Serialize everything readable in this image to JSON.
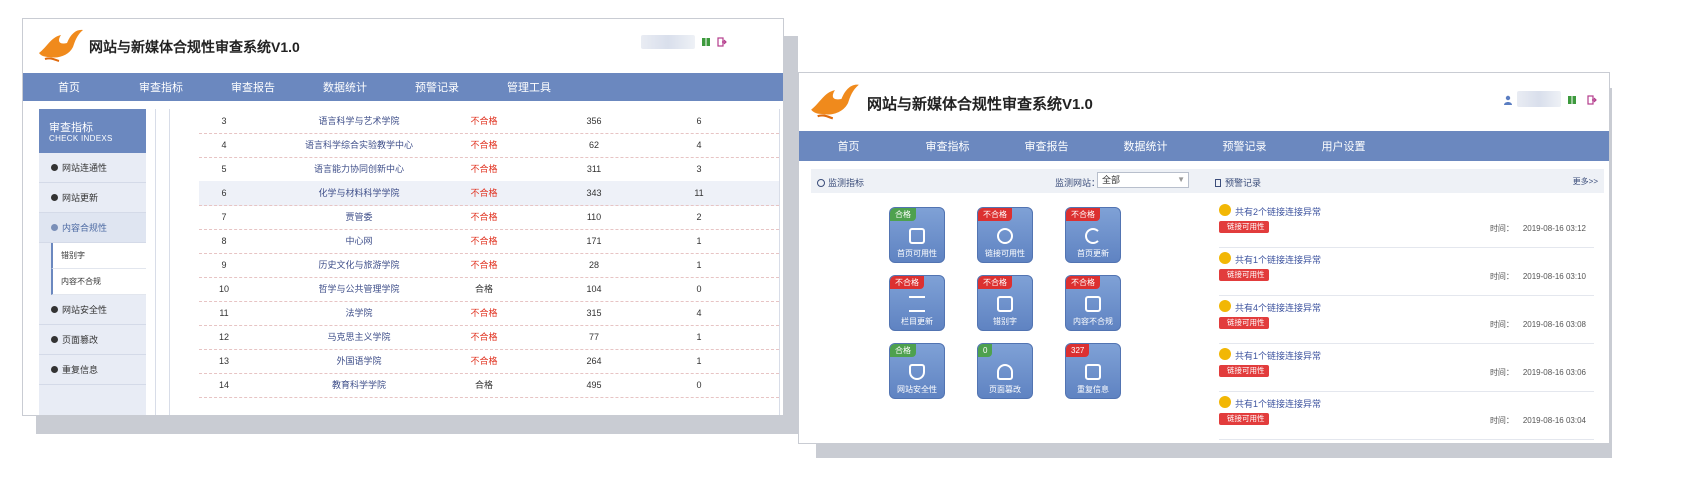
{
  "app": {
    "title": "网站与新媒体合规性审查系统V1.0"
  },
  "left_window": {
    "nav": [
      "首页",
      "审查指标",
      "审查报告",
      "数据统计",
      "预警记录",
      "管理工具"
    ],
    "sidebar": {
      "head_title": "审查指标",
      "head_subtitle": "CHECK INDEXS",
      "items": [
        "网站连通性",
        "网站更新",
        "内容合规性",
        "网站安全性",
        "页面篡改",
        "重复信息"
      ],
      "sub_items": [
        "错别字",
        "内容不合规"
      ]
    },
    "rows": [
      {
        "no": "3",
        "name": "语言科学与艺术学院",
        "status": "不合格",
        "a": "356",
        "b": "6"
      },
      {
        "no": "4",
        "name": "语言科学综合实验教学中心",
        "status": "不合格",
        "a": "62",
        "b": "4"
      },
      {
        "no": "5",
        "name": "语言能力协同创新中心",
        "status": "不合格",
        "a": "311",
        "b": "3"
      },
      {
        "no": "6",
        "name": "化学与材料科学学院",
        "status": "不合格",
        "a": "343",
        "b": "11"
      },
      {
        "no": "7",
        "name": "贾管委",
        "status": "不合格",
        "a": "110",
        "b": "2"
      },
      {
        "no": "8",
        "name": "中心网",
        "status": "不合格",
        "a": "171",
        "b": "1"
      },
      {
        "no": "9",
        "name": "历史文化与旅游学院",
        "status": "不合格",
        "a": "28",
        "b": "1"
      },
      {
        "no": "10",
        "name": "哲学与公共管理学院",
        "status": "合格",
        "a": "104",
        "b": "0"
      },
      {
        "no": "11",
        "name": "法学院",
        "status": "不合格",
        "a": "315",
        "b": "4"
      },
      {
        "no": "12",
        "name": "马克思主义学院",
        "status": "不合格",
        "a": "77",
        "b": "1"
      },
      {
        "no": "13",
        "name": "外国语学院",
        "status": "不合格",
        "a": "264",
        "b": "1"
      },
      {
        "no": "14",
        "name": "教育科学学院",
        "status": "合格",
        "a": "495",
        "b": "0"
      }
    ]
  },
  "right_window": {
    "nav": [
      "首页",
      "审查指标",
      "审查报告",
      "数据统计",
      "预警记录",
      "用户设置"
    ],
    "monitor": {
      "title": "监测指标",
      "site_label": "监测网站：",
      "site_value": "全部",
      "tiles": [
        {
          "badge": "合格",
          "label": "首页可用性",
          "badge_color": "#4ea14e"
        },
        {
          "badge": "不合格",
          "label": "链接可用性",
          "badge_color": "#dc3030"
        },
        {
          "badge": "不合格",
          "label": "首页更新",
          "badge_color": "#dc3030"
        },
        {
          "badge": "不合格",
          "label": "栏目更新",
          "badge_color": "#dc3030"
        },
        {
          "badge": "不合格",
          "label": "错别字",
          "badge_color": "#dc3030"
        },
        {
          "badge": "不合格",
          "label": "内容不合规",
          "badge_color": "#dc3030"
        },
        {
          "badge": "合格",
          "label": "网站安全性",
          "badge_color": "#4ea14e"
        },
        {
          "badge": "0",
          "label": "页面篡改",
          "badge_color": "#4ea14e"
        },
        {
          "badge": "327",
          "label": "重复信息",
          "badge_color": "#dc3030"
        }
      ]
    },
    "alerts": {
      "title": "预警记录",
      "more": "更多>>",
      "time_label": "时间：",
      "items": [
        {
          "title": "共有2个链接连接异常",
          "tag": "链接可用性",
          "time": "2019-08-16 03:12"
        },
        {
          "title": "共有1个链接连接异常",
          "tag": "链接可用性",
          "time": "2019-08-16 03:10"
        },
        {
          "title": "共有4个链接连接异常",
          "tag": "链接可用性",
          "time": "2019-08-16 03:08"
        },
        {
          "title": "共有1个链接连接异常",
          "tag": "链接可用性",
          "time": "2019-08-16 03:06"
        },
        {
          "title": "共有1个链接连接异常",
          "tag": "链接可用性",
          "time": "2019-08-16 03:04"
        }
      ]
    }
  },
  "colors": {
    "nav": "#6b88bf",
    "fail": "#e0301e",
    "pass_badge": "#4ea14e",
    "fail_badge": "#dc3030",
    "alert_dot": "#f2b705"
  }
}
